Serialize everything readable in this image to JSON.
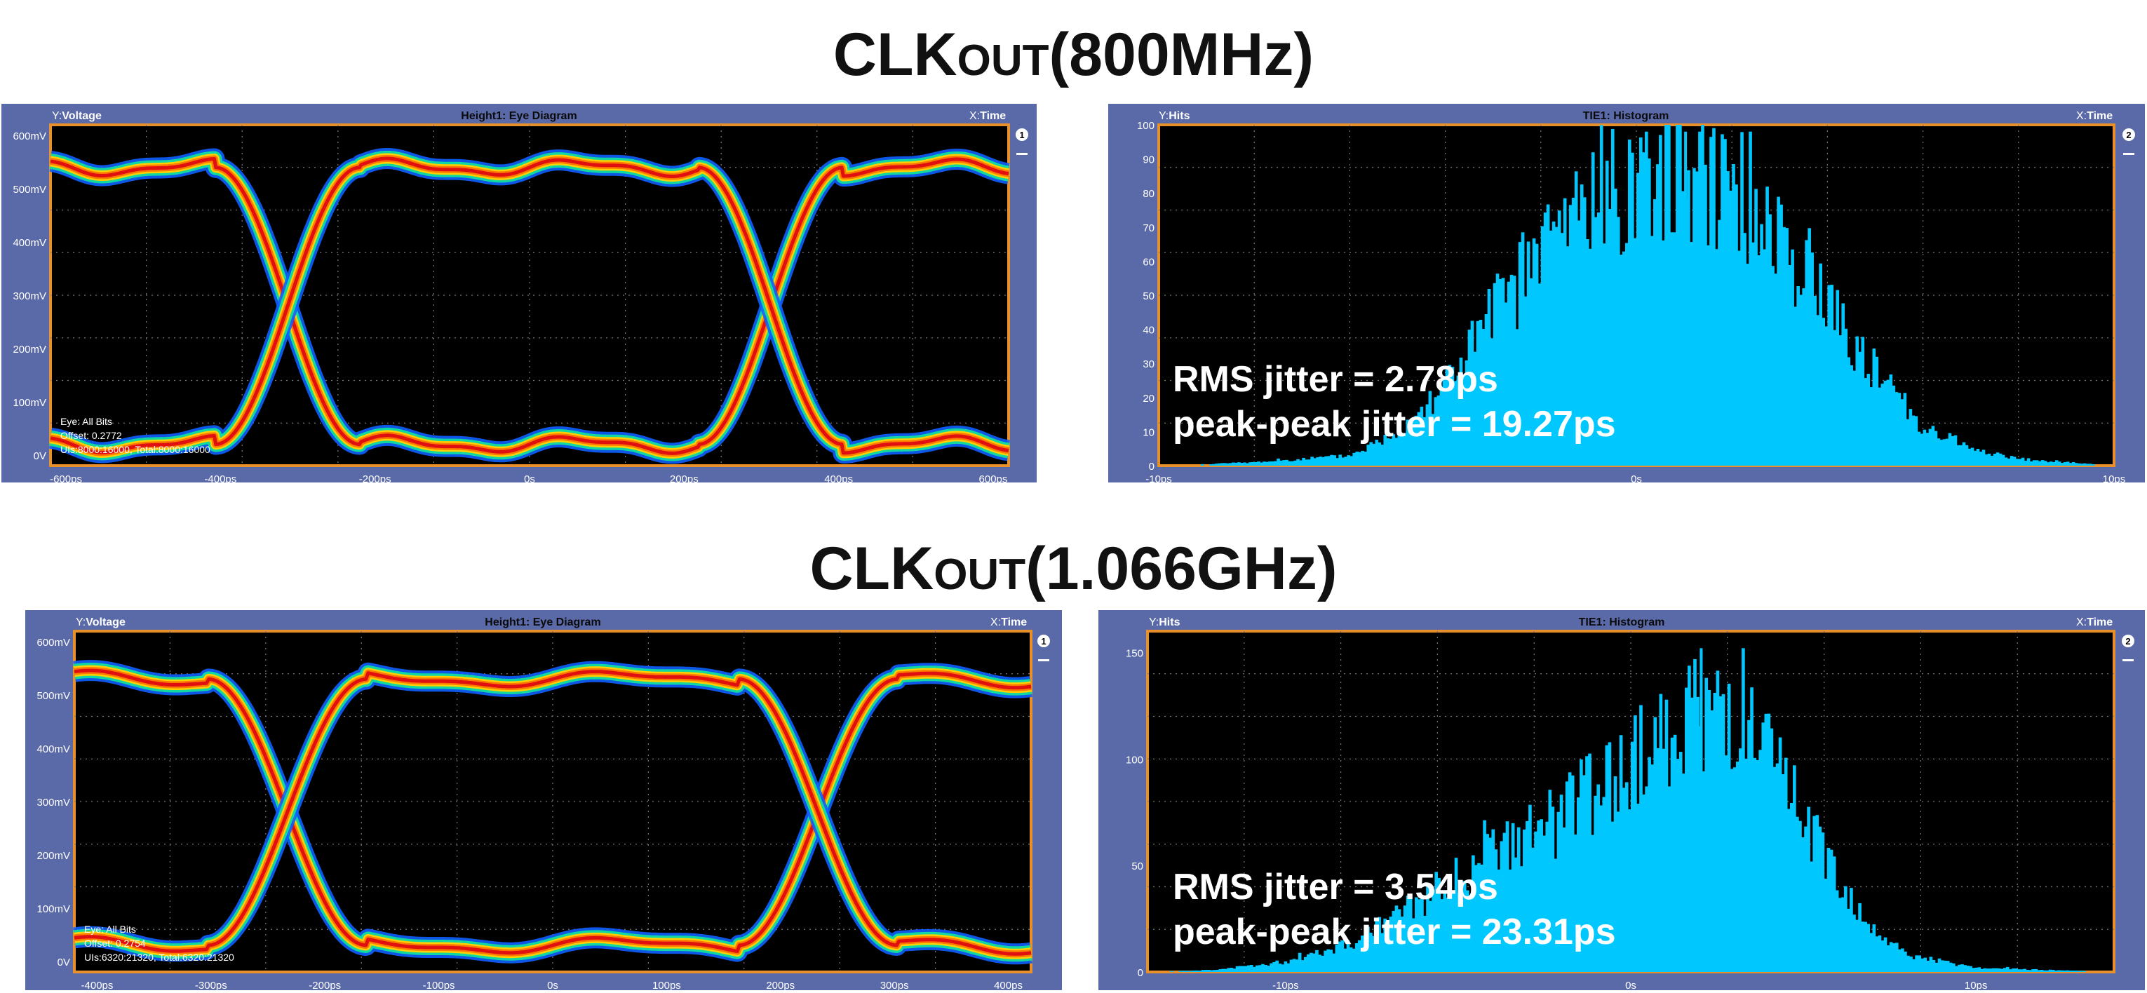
{
  "sections": [
    {
      "title_main": "CLK",
      "title_sub": "OUT",
      "title_tail": "(800MHz)",
      "eye": {
        "ylabel_prefix": "Y:",
        "ylabel": "Voltage",
        "title": "Height1: Eye Diagram",
        "xlabel_prefix": "X:",
        "xlabel": "Time",
        "badge": "1",
        "info": [
          "Eye: All Bits",
          "Offset: 0.2772",
          "UIs:8000:16000, Total:8000:16000"
        ]
      },
      "hist": {
        "ylabel_prefix": "Y:",
        "ylabel": "Hits",
        "title": "TIE1: Histogram",
        "xlabel_prefix": "X:",
        "xlabel": "Time",
        "badge": "2",
        "rms": "RMS jitter = 2.78ps",
        "pp": "peak-peak jitter = 19.27ps"
      }
    },
    {
      "title_main": "CLK",
      "title_sub": "OUT",
      "title_tail": "(1.066GHz)",
      "eye": {
        "ylabel_prefix": "Y:",
        "ylabel": "Voltage",
        "title": "Height1: Eye Diagram",
        "xlabel_prefix": "X:",
        "xlabel": "Time",
        "badge": "1",
        "info": [
          "Eye: All Bits",
          "Offset: 0.2754",
          "UIs:6320:21320, Total:6320:21320"
        ]
      },
      "hist": {
        "ylabel_prefix": "Y:",
        "ylabel": "Hits",
        "title": "TIE1: Histogram",
        "xlabel_prefix": "X:",
        "xlabel": "Time",
        "badge": "2",
        "rms": "RMS jitter = 3.54ps",
        "pp": "peak-peak jitter = 23.31ps"
      }
    }
  ],
  "colors": {
    "panel": "#5a6aa8",
    "plot_bg": "#000000",
    "plot_border": "#e8912a",
    "grid": "#777777",
    "hist_bar": "#00c8ff",
    "eye_core": "#e01010",
    "eye_mid": "#ffd000",
    "eye_outer": "#1060ff"
  },
  "chart_data": [
    {
      "type": "line",
      "kind": "eye_diagram",
      "xlabel": "Time",
      "ylabel": "Voltage",
      "xlim": [
        -620,
        620
      ],
      "ylim": [
        -20,
        620
      ],
      "xticks": [
        -600,
        -400,
        -200,
        0,
        200,
        400,
        600
      ],
      "xtick_labels": [
        "-600ps",
        "-400ps",
        "-200ps",
        "0s",
        "200ps",
        "400ps",
        "600ps"
      ],
      "yticks": [
        0,
        100,
        200,
        300,
        400,
        500,
        600
      ],
      "ytick_labels": [
        "0V",
        "100mV",
        "200mV",
        "300mV",
        "400mV",
        "500mV",
        "600mV"
      ],
      "high_level": 540,
      "low_level": 20,
      "crossing_voltage": 310,
      "crossings_ps": [
        -313,
        312
      ],
      "grid": true
    },
    {
      "type": "bar",
      "kind": "histogram",
      "xlabel": "Time",
      "ylabel": "Hits",
      "xlim": [
        -10,
        10
      ],
      "ylim": [
        0,
        100
      ],
      "xticks": [
        -10,
        0,
        10
      ],
      "xtick_labels": [
        "-10ps",
        "0s",
        "10ps"
      ],
      "yticks": [
        0,
        10,
        20,
        30,
        40,
        50,
        60,
        70,
        80,
        90,
        100
      ],
      "ytick_labels": [
        "0",
        "10",
        "20",
        "30",
        "40",
        "50",
        "60",
        "70",
        "80",
        "90",
        "100"
      ],
      "peak_hits": 98,
      "envelope_x_ps": [
        -10,
        -8,
        -6,
        -5,
        -4,
        -3,
        -2,
        -1,
        0,
        1,
        2,
        3,
        4,
        5,
        6,
        7,
        8,
        10
      ],
      "envelope_hits": [
        0,
        1,
        3,
        10,
        25,
        45,
        65,
        80,
        88,
        92,
        86,
        70,
        50,
        28,
        12,
        5,
        2,
        0
      ],
      "grid": true
    },
    {
      "type": "line",
      "kind": "eye_diagram",
      "xlabel": "Time",
      "ylabel": "Voltage",
      "xlim": [
        -420,
        420
      ],
      "ylim": [
        -20,
        620
      ],
      "xticks": [
        -400,
        -300,
        -200,
        -100,
        0,
        100,
        200,
        300,
        400
      ],
      "xtick_labels": [
        "-400ps",
        "-300ps",
        "-200ps",
        "-100ps",
        "0s",
        "100ps",
        "200ps",
        "300ps",
        "400ps"
      ],
      "yticks": [
        0,
        100,
        200,
        300,
        400,
        500,
        600
      ],
      "ytick_labels": [
        "0V",
        "100mV",
        "200mV",
        "300mV",
        "400mV",
        "500mV",
        "600mV"
      ],
      "high_level": 530,
      "low_level": 30,
      "crossing_voltage": 280,
      "crossings_ps": [
        -233,
        233
      ],
      "grid": true
    },
    {
      "type": "bar",
      "kind": "histogram",
      "xlabel": "Time",
      "ylabel": "Hits",
      "xlim": [
        -14,
        14
      ],
      "ylim": [
        0,
        160
      ],
      "xticks": [
        -10,
        0,
        10
      ],
      "xtick_labels": [
        "-10ps",
        "0s",
        "10ps"
      ],
      "yticks": [
        0,
        50,
        100,
        150
      ],
      "ytick_labels": [
        "0",
        "50",
        "100",
        "150"
      ],
      "peak_hits": 152,
      "envelope_x_ps": [
        -14,
        -12,
        -10,
        -8,
        -6,
        -4,
        -2,
        0,
        1,
        2,
        3,
        4,
        5,
        6,
        7,
        8,
        10,
        14
      ],
      "envelope_hits": [
        0,
        1,
        5,
        15,
        35,
        55,
        75,
        100,
        115,
        128,
        122,
        100,
        75,
        45,
        20,
        8,
        2,
        0
      ],
      "grid": true
    }
  ]
}
